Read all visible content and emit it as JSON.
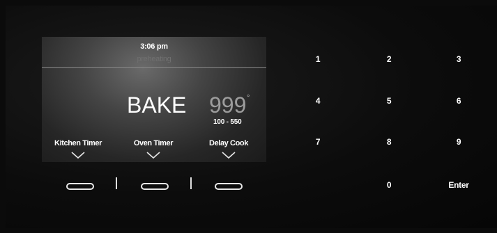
{
  "display": {
    "time": "3:06 pm",
    "status": "preheating",
    "mode": "BAKE",
    "temperature": "999",
    "degree_symbol": "°",
    "range": "100 - 550"
  },
  "options": [
    {
      "label": "Kitchen Timer",
      "icon": "chevron-down-icon"
    },
    {
      "label": "Oven Timer",
      "icon": "chevron-down-icon"
    },
    {
      "label": "Delay Cook",
      "icon": "chevron-down-icon"
    }
  ],
  "keypad": {
    "k1": "1",
    "k2": "2",
    "k3": "3",
    "k4": "4",
    "k5": "5",
    "k6": "6",
    "k7": "7",
    "k8": "8",
    "k9": "9",
    "k0": "0",
    "enter": "Enter"
  },
  "colors": {
    "background": "#0b0b0b",
    "text": "#ffffff",
    "temperature": "#9c9c9c",
    "status": "#707070"
  }
}
